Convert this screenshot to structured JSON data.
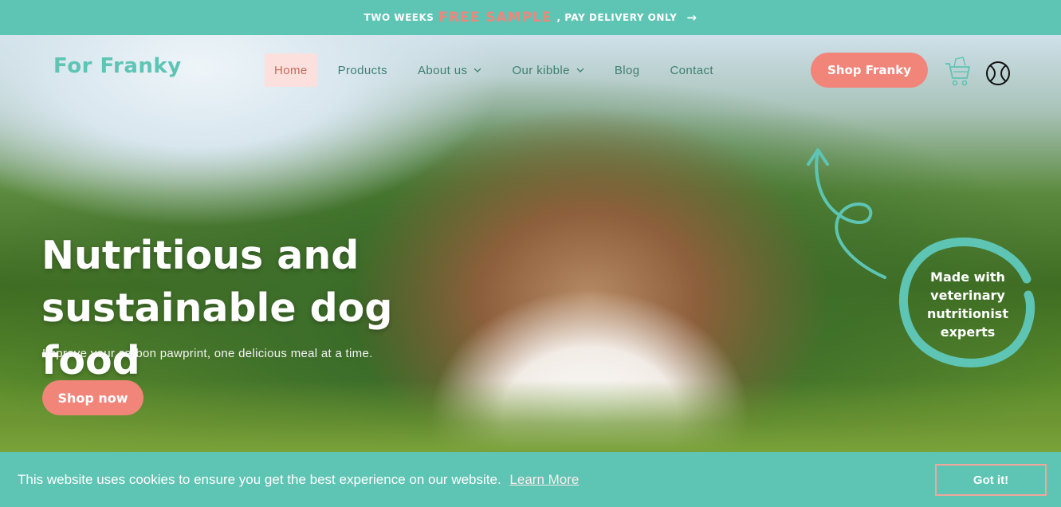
{
  "announcement": {
    "before": "TWO WEEKS",
    "highlight": "FREE SAMPLE",
    "after": ", PAY DELIVERY ONLY",
    "arrow": "→"
  },
  "header": {
    "logo": "For Franky",
    "nav": [
      {
        "label": "Home",
        "active": true
      },
      {
        "label": "Products"
      },
      {
        "label": "About us",
        "dropdown": true
      },
      {
        "label": "Our kibble",
        "dropdown": true
      },
      {
        "label": "Blog"
      },
      {
        "label": "Contact"
      }
    ],
    "chevron": "⌄",
    "cta": "Shop Franky",
    "icons": [
      "cart-icon",
      "ball-icon"
    ]
  },
  "hero": {
    "title_line1": "Nutritious and",
    "title_line2": "sustainable dog food",
    "subtitle": "Improve your carbon pawprint, one delicious meal at a time.",
    "cta": "Shop now",
    "badge": [
      "Made with",
      "veterinary",
      "nutritionist",
      "experts"
    ]
  },
  "cookie": {
    "message": "This website uses cookies to ensure you get the best experience on our website.",
    "link": "Learn More",
    "button": "Got it!"
  },
  "colors": {
    "teal": "#5ec4b4",
    "coral": "#f2857a",
    "nav_text": "#3f7f70",
    "active_bg": "#fbe0dd"
  }
}
